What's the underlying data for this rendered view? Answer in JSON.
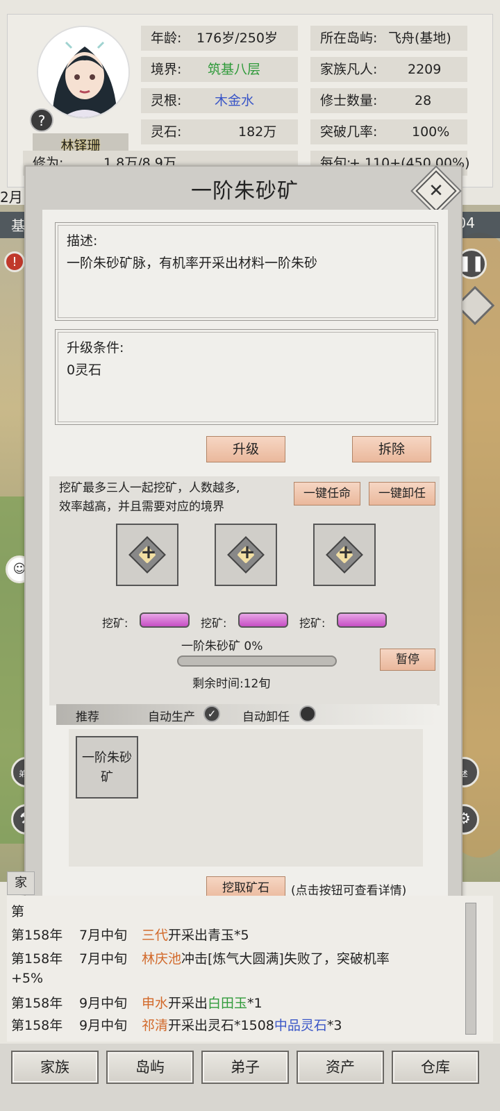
{
  "player": {
    "name": "林铎珊",
    "age_label": "年龄:",
    "age_value": "176岁/250岁",
    "realm_label": "境界:",
    "realm_value": "筑基八层",
    "root_label": "灵根:",
    "root_value": "木金水",
    "stone_label": "灵石:",
    "stone_value": "182万",
    "cultivation_label": "修为:",
    "cultivation_value": "1.8万/8.9万",
    "island_label": "所在岛屿:",
    "island_value": "飞舟(基地)",
    "mortals_label": "家族凡人:",
    "mortals_value": "2209",
    "cultivators_label": "修士数量:",
    "cultivators_value": "28",
    "breakthrough_label": "突破几率:",
    "breakthrough_value": "100%",
    "per_turn_label": "每旬:",
    "per_turn_value": "+ 110+(450.00%)"
  },
  "map": {
    "month_label": "2月",
    "base_bar_left": "基地",
    "base_bar_right": "04"
  },
  "dialog": {
    "title": "一阶朱砂矿",
    "desc_heading": "描述:",
    "desc_text": "一阶朱砂矿脉，有机率开采出材料一阶朱砂",
    "upgrade_heading": "升级条件:",
    "upgrade_text": "0灵石",
    "upgrade_button": "升级",
    "demolish_button": "拆除",
    "mine_desc_line1": "挖矿最多三人一起挖矿，人数越多,",
    "mine_desc_line2": "效率越高，并且需要对应的境界",
    "appoint_all_button": "一键任命",
    "dismiss_all_button": "一键卸任",
    "slot_labels": [
      "挖矿:",
      "挖矿:",
      "挖矿:"
    ],
    "product_progress_label": "一阶朱砂矿 0%",
    "product_progress": 0,
    "remaining_time": "剩余时间:12旬",
    "pause_button": "暂停",
    "tab_recommend": "推荐",
    "auto_produce_label": "自动生产",
    "auto_produce_checked": true,
    "auto_dismiss_label": "自动卸任",
    "auto_dismiss_checked": false,
    "recipe_item_line1": "一阶朱砂",
    "recipe_item_line2": "矿",
    "mine_ore_button": "挖取矿石",
    "mine_ore_hint": "(点击按钮可查看详情)"
  },
  "side": {
    "disciple_label": "弟子",
    "describe_label": "述"
  },
  "log": {
    "tab_label": "家",
    "entries": [
      {
        "year": "第",
        "date": "",
        "segments": []
      },
      {
        "year": "第158年",
        "date": "7月中旬",
        "segments": [
          {
            "text": "三代",
            "color": "orange"
          },
          {
            "text": "开采出青玉*5",
            "color": "black"
          }
        ]
      },
      {
        "year": "第158年",
        "date": "7月中旬",
        "segments": [
          {
            "text": "林庆池",
            "color": "orange"
          },
          {
            "text": "冲击[炼气大圆满]失败了，突破机率",
            "color": "black"
          }
        ]
      },
      {
        "year": "",
        "date": "",
        "segments": [
          {
            "text": "+5%",
            "color": "black"
          }
        ]
      },
      {
        "year": "第158年",
        "date": "9月中旬",
        "segments": [
          {
            "text": "申水",
            "color": "orange"
          },
          {
            "text": "开采出",
            "color": "black"
          },
          {
            "text": "白田玉",
            "color": "green"
          },
          {
            "text": "*1",
            "color": "black"
          }
        ]
      },
      {
        "year": "第158年",
        "date": "9月中旬",
        "segments": [
          {
            "text": "祁清",
            "color": "orange"
          },
          {
            "text": "开采出灵石*1508",
            "color": "black"
          },
          {
            "text": "中品灵石",
            "color": "blue"
          },
          {
            "text": "*3",
            "color": "black"
          }
        ]
      }
    ]
  },
  "nav": {
    "items": [
      "家族",
      "岛屿",
      "弟子",
      "资产",
      "仓库"
    ]
  },
  "colors": {
    "accent_peach": "#eab89c",
    "purple_bar": "#c64fc4",
    "green_text": "#2f9a3a",
    "blue_text": "#3a56c7",
    "orange_text": "#d2692a"
  }
}
